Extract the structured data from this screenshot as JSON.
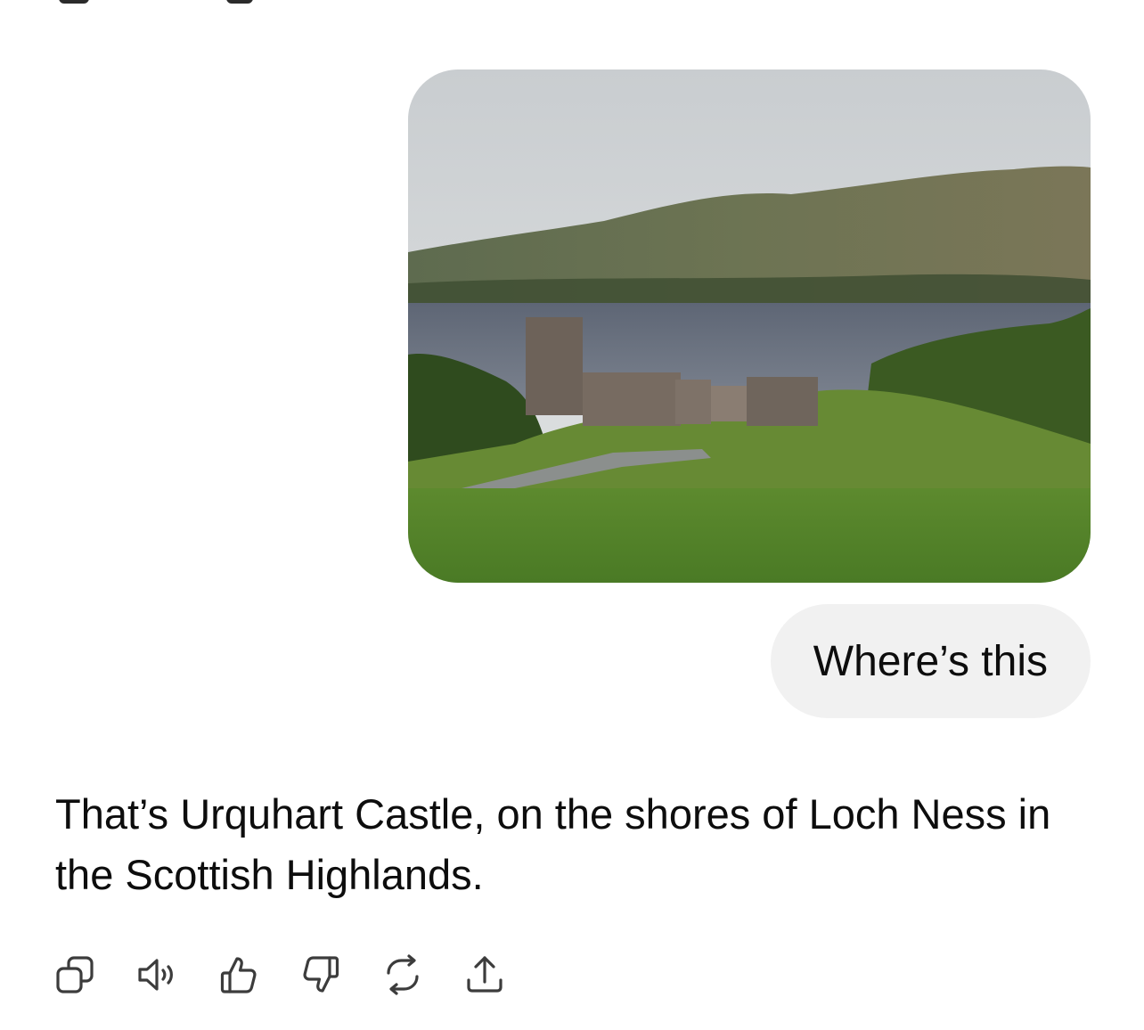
{
  "conversation": {
    "image": {
      "alt": ""
    },
    "user_message": "Where’s this",
    "assistant_message": "That’s Urquhart Castle, on the shores of Loch Ness in the Scottish Highlands."
  },
  "actions": [
    {
      "icon": "copy-icon"
    },
    {
      "icon": "read-aloud-icon"
    },
    {
      "icon": "thumbs-up-icon"
    },
    {
      "icon": "thumbs-down-icon"
    },
    {
      "icon": "regenerate-icon"
    },
    {
      "icon": "share-icon"
    }
  ],
  "colors": {
    "bubble_bg": "#f1f1f1",
    "text": "#0d0d0d",
    "icon": "#3c3c3c"
  }
}
